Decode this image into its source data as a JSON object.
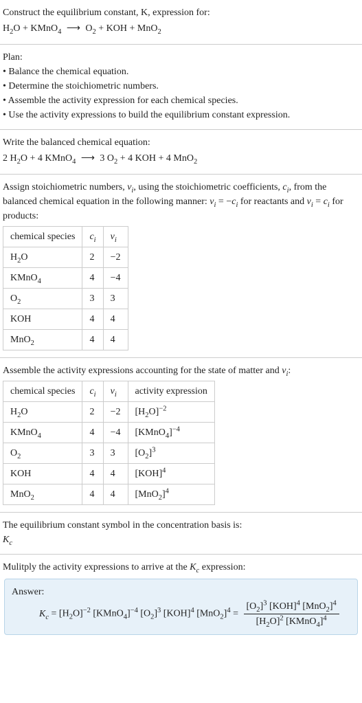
{
  "intro": {
    "line1": "Construct the equilibrium constant, K, expression for:",
    "equation_plain": "H₂O + KMnO₄ ⟶ O₂ + KOH + MnO₂"
  },
  "plan": {
    "heading": "Plan:",
    "b1": "• Balance the chemical equation.",
    "b2": "• Determine the stoichiometric numbers.",
    "b3": "• Assemble the activity expression for each chemical species.",
    "b4": "• Use the activity expressions to build the equilibrium constant expression."
  },
  "balanced": {
    "heading": "Write the balanced chemical equation:",
    "equation_plain": "2 H₂O + 4 KMnO₄ ⟶ 3 O₂ + 4 KOH + 4 MnO₂"
  },
  "stoich": {
    "text_part_a": "Assign stoichiometric numbers, ",
    "text_part_b": ", using the stoichiometric coefficients, ",
    "text_part_c": ", from the balanced chemical equation in the following manner: ",
    "text_part_d": " for reactants and ",
    "text_part_e": " for products:",
    "table": {
      "h1": "chemical species",
      "r1": {
        "sp": "H₂O",
        "c": "2",
        "v": "−2"
      },
      "r2": {
        "sp": "KMnO₄",
        "c": "4",
        "v": "−4"
      },
      "r3": {
        "sp": "O₂",
        "c": "3",
        "v": "3"
      },
      "r4": {
        "sp": "KOH",
        "c": "4",
        "v": "4"
      },
      "r5": {
        "sp": "MnO₂",
        "c": "4",
        "v": "4"
      }
    }
  },
  "activity": {
    "text_a": "Assemble the activity expressions accounting for the state of matter and ",
    "text_b": ":",
    "table": {
      "h1": "chemical species",
      "h4": "activity expression",
      "r1": {
        "sp": "H₂O",
        "c": "2",
        "v": "−2"
      },
      "r2": {
        "sp": "KMnO₄",
        "c": "4",
        "v": "−4"
      },
      "r3": {
        "sp": "O₂",
        "c": "3",
        "v": "3"
      },
      "r4": {
        "sp": "KOH",
        "c": "4",
        "v": "4"
      },
      "r5": {
        "sp": "MnO₂",
        "c": "4",
        "v": "4"
      }
    }
  },
  "symbol": {
    "line": "The equilibrium constant symbol in the concentration basis is:"
  },
  "multiply": {
    "text_a": "Mulitply the activity expressions to arrive at the ",
    "text_b": " expression:"
  },
  "answer": {
    "label": "Answer:"
  },
  "chem": {
    "H2O": "H₂O",
    "KMnO4": "KMnO₄",
    "O2": "O₂",
    "KOH": "KOH",
    "MnO2": "MnO₂"
  },
  "chart_data": {
    "type": "table",
    "title": "Stoichiometric numbers and activity expressions",
    "columns": [
      "chemical species",
      "c_i",
      "ν_i",
      "activity expression"
    ],
    "rows": [
      {
        "species": "H2O",
        "c_i": 2,
        "nu_i": -2,
        "activity": "[H2O]^-2"
      },
      {
        "species": "KMnO4",
        "c_i": 4,
        "nu_i": -4,
        "activity": "[KMnO4]^-4"
      },
      {
        "species": "O2",
        "c_i": 3,
        "nu_i": 3,
        "activity": "[O2]^3"
      },
      {
        "species": "KOH",
        "c_i": 4,
        "nu_i": 4,
        "activity": "[KOH]^4"
      },
      {
        "species": "MnO2",
        "c_i": 4,
        "nu_i": 4,
        "activity": "[MnO2]^4"
      }
    ],
    "balanced_equation": "2 H2O + 4 KMnO4 -> 3 O2 + 4 KOH + 4 MnO2",
    "Kc_expression": "Kc = [H2O]^-2 [KMnO4]^-4 [O2]^3 [KOH]^4 [MnO2]^4 = ([O2]^3 [KOH]^4 [MnO2]^4) / ([H2O]^2 [KMnO4]^4)"
  }
}
